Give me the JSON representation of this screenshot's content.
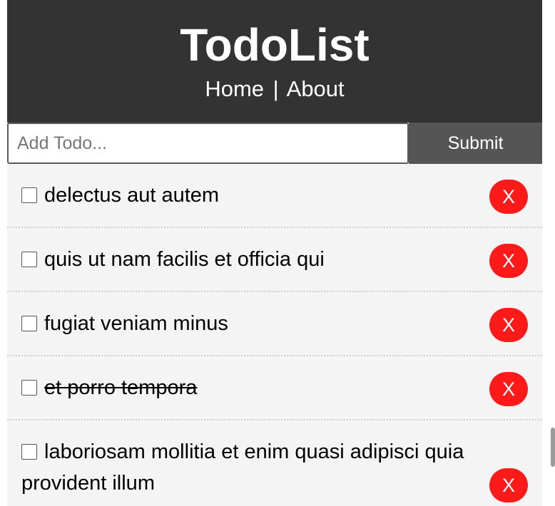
{
  "header": {
    "title": "TodoList",
    "nav": {
      "home": "Home",
      "separator": "|",
      "about": "About"
    }
  },
  "form": {
    "placeholder": "Add Todo...",
    "submit_label": "Submit"
  },
  "todos": [
    {
      "title": "delectus aut autem",
      "completed": false,
      "delete_label": "X"
    },
    {
      "title": "quis ut nam facilis et officia qui",
      "completed": false,
      "delete_label": "X"
    },
    {
      "title": "fugiat veniam minus",
      "completed": false,
      "delete_label": "X"
    },
    {
      "title": "et porro tempora",
      "completed": true,
      "delete_label": "X"
    },
    {
      "title": "laboriosam mollitia et enim quasi adipisci quia provident illum",
      "completed": false,
      "delete_label": "X"
    }
  ],
  "colors": {
    "header_bg": "#333333",
    "submit_bg": "#555555",
    "delete_bg": "#ff1a1a",
    "item_bg": "#f4f4f4"
  }
}
